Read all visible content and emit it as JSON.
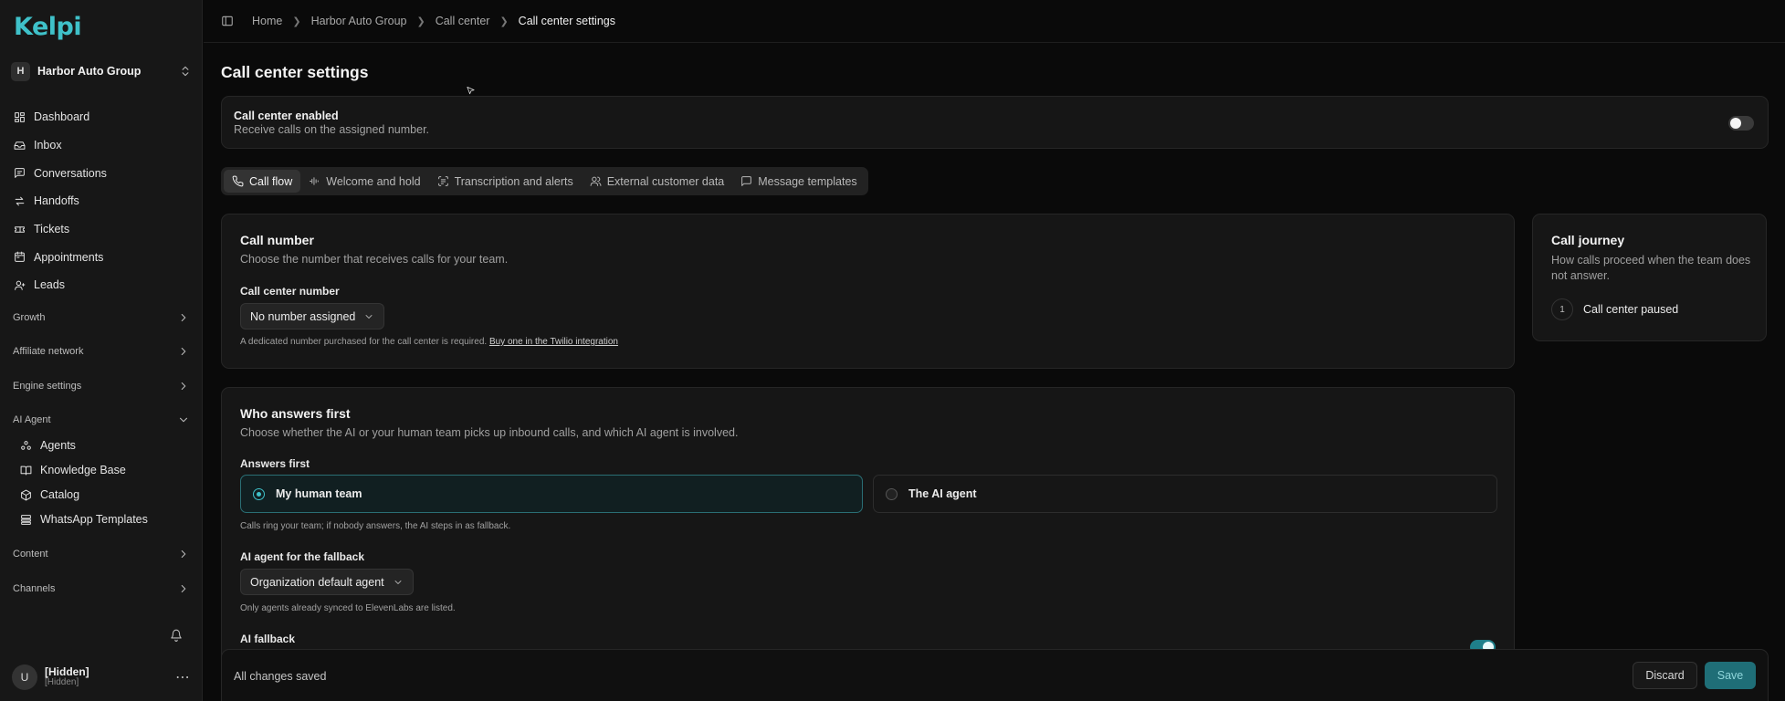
{
  "app": {
    "logo": "Kelpi"
  },
  "org": {
    "initial": "H",
    "name": "Harbor Auto Group"
  },
  "nav": {
    "items": [
      {
        "label": "Dashboard",
        "icon": "dashboard-icon"
      },
      {
        "label": "Inbox",
        "icon": "inbox-icon"
      },
      {
        "label": "Conversations",
        "icon": "conversations-icon"
      },
      {
        "label": "Handoffs",
        "icon": "handoffs-icon"
      },
      {
        "label": "Tickets",
        "icon": "tickets-icon"
      },
      {
        "label": "Appointments",
        "icon": "calendar-icon"
      },
      {
        "label": "Leads",
        "icon": "leads-icon"
      }
    ],
    "sections": {
      "growth": "Growth",
      "affiliate": "Affiliate network",
      "engine": "Engine settings",
      "ai_agent": "AI Agent",
      "content": "Content",
      "channels": "Channels"
    },
    "ai_agent_items": {
      "agents": "Agents",
      "knowledge": "Knowledge Base",
      "catalog": "Catalog",
      "whatsapp": "WhatsApp Templates"
    }
  },
  "user": {
    "initial": "U",
    "name": "[Hidden]",
    "email": "[Hidden]"
  },
  "breadcrumb": {
    "home": "Home",
    "org": "Harbor Auto Group",
    "call_center": "Call center",
    "current": "Call center settings"
  },
  "page": {
    "title": "Call center settings"
  },
  "enable": {
    "title": "Call center enabled",
    "subtitle": "Receive calls on the assigned number.",
    "enabled": false
  },
  "tabs": {
    "call_flow": "Call flow",
    "welcome": "Welcome and hold",
    "transcription": "Transcription and alerts",
    "external": "External customer data",
    "templates": "Message templates"
  },
  "call_number": {
    "title": "Call number",
    "subtitle": "Choose the number that receives calls for your team.",
    "label": "Call center number",
    "value": "No number assigned",
    "hint": "A dedicated number purchased for the call center is required.",
    "hint_link": "Buy one in the Twilio integration"
  },
  "who_answers": {
    "title": "Who answers first",
    "subtitle": "Choose whether the AI or your human team picks up inbound calls, and which AI agent is involved.",
    "label": "Answers first",
    "option_human": "My human team",
    "option_ai": "The AI agent",
    "selected": "My human team",
    "hint": "Calls ring your team; if nobody answers, the AI steps in as fallback.",
    "agent_label": "AI agent for the fallback",
    "agent_value": "Organization default agent",
    "agent_hint": "Only agents already synced to ElevenLabs are listed.",
    "fallback_label": "AI fallback",
    "fallback_enabled": true
  },
  "journey": {
    "title": "Call journey",
    "subtitle": "How calls proceed when the team does not answer.",
    "step_num": "1",
    "step_text": "Call center paused"
  },
  "savebar": {
    "status": "All changes saved",
    "discard": "Discard",
    "save": "Save"
  },
  "colors": {
    "accent": "#3fc1c9",
    "background": "#0a0a0a",
    "card": "#161616"
  }
}
